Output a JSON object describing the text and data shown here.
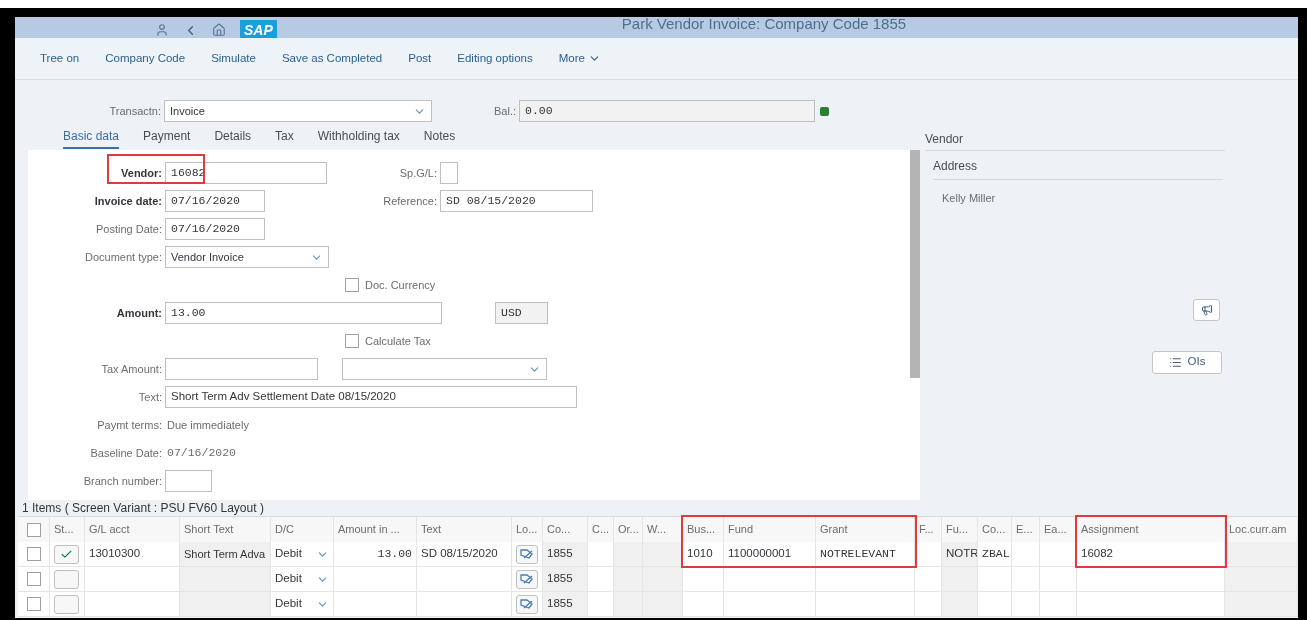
{
  "shell": {
    "logo": "SAP",
    "title": "Park Vendor Invoice: Company Code 1855"
  },
  "toolbar": [
    "Tree on",
    "Company Code",
    "Simulate",
    "Save as Completed",
    "Post",
    "Editing options",
    "More"
  ],
  "transaction": {
    "label": "Transactn:",
    "value": "Invoice"
  },
  "balance": {
    "label": "Bal.:",
    "value": "0.00",
    "balanced": true
  },
  "tabs": [
    {
      "label": "Basic data",
      "selected": true
    },
    {
      "label": "Payment",
      "selected": false
    },
    {
      "label": "Details",
      "selected": false
    },
    {
      "label": "Tax",
      "selected": false
    },
    {
      "label": "Withholding tax",
      "selected": false
    },
    {
      "label": "Notes",
      "selected": false
    }
  ],
  "form": {
    "vendor": {
      "label": "Vendor:",
      "value": "16082",
      "required": true,
      "highlighted": true
    },
    "sp_gl": {
      "label": "Sp.G/L:"
    },
    "invoice_date": {
      "label": "Invoice date:",
      "value": "07/16/2020",
      "required": true
    },
    "reference": {
      "label": "Reference:",
      "value": "SD 08/15/2020"
    },
    "posting_date": {
      "label": "Posting Date:",
      "value": "07/16/2020",
      "required": false
    },
    "document_type": {
      "label": "Document type:",
      "value": "Vendor Invoice",
      "required": false
    },
    "doc_currency": {
      "label": "Doc. Currency",
      "checked": false
    },
    "amount": {
      "label": "Amount:",
      "value": "13.00",
      "required": true
    },
    "currency": {
      "value": "USD"
    },
    "calculate_tax": {
      "label": "Calculate Tax",
      "checked": false
    },
    "tax_amount": {
      "label": "Tax Amount:",
      "required": false
    },
    "text": {
      "label": "Text:",
      "value": "Short Term Adv Settlement Date 08/15/2020",
      "required": false
    },
    "payment_terms": {
      "label": "Paymt terms:",
      "value": "Due immediately"
    },
    "baseline_date": {
      "label": "Baseline Date:",
      "value": "07/16/2020"
    },
    "branch_number": {
      "label": "Branch number:"
    }
  },
  "vendor_panel": {
    "title": "Vendor",
    "section": "Address",
    "name": "Kelly Miller",
    "list_button": "OIs"
  },
  "items": {
    "title": "1 Items ( Screen Variant : PSU FV60 Layout )",
    "select_all": false,
    "columns": [
      {
        "label": "St...",
        "kind": "status",
        "highlighted": false,
        "readonly": false
      },
      {
        "label": "G/L acct",
        "kind": "text",
        "highlighted": false,
        "readonly": false
      },
      {
        "label": "Short Text",
        "kind": "text",
        "highlighted": false,
        "readonly": true
      },
      {
        "label": "D/C",
        "kind": "dropdown",
        "highlighted": false,
        "readonly": false
      },
      {
        "label": "Amount in ...",
        "kind": "number",
        "highlighted": false,
        "readonly": false
      },
      {
        "label": "Text",
        "kind": "text",
        "highlighted": false,
        "readonly": false
      },
      {
        "label": "Lo...",
        "kind": "icon",
        "highlighted": false,
        "readonly": false
      },
      {
        "label": "Co...",
        "kind": "text",
        "highlighted": false,
        "readonly": true
      },
      {
        "label": "C...",
        "kind": "text",
        "highlighted": false,
        "readonly": false
      },
      {
        "label": "Or...",
        "kind": "text",
        "highlighted": false,
        "readonly": true
      },
      {
        "label": "W...",
        "kind": "text",
        "highlighted": false,
        "readonly": true
      },
      {
        "label": "Bus...",
        "kind": "text",
        "highlighted": true,
        "readonly": false
      },
      {
        "label": "Fund",
        "kind": "text",
        "highlighted": true,
        "readonly": false
      },
      {
        "label": "Grant",
        "kind": "code",
        "highlighted": true,
        "readonly": false
      },
      {
        "label": "F...",
        "kind": "text",
        "highlighted": false,
        "readonly": false
      },
      {
        "label": "Fu...",
        "kind": "text",
        "highlighted": false,
        "readonly": true
      },
      {
        "label": "Co...",
        "kind": "code",
        "highlighted": false,
        "readonly": false
      },
      {
        "label": "E...",
        "kind": "text",
        "highlighted": false,
        "readonly": false
      },
      {
        "label": "Ea...",
        "kind": "text",
        "highlighted": false,
        "readonly": false
      },
      {
        "label": "Assignment",
        "kind": "text",
        "highlighted": true,
        "readonly": false
      },
      {
        "label": "Loc.curr.am",
        "kind": "text",
        "highlighted": false,
        "readonly": true
      }
    ],
    "rows": [
      {
        "checked": false,
        "confirmed": true,
        "cells": [
          null,
          "13010300",
          "Short Term Adva",
          "Debit",
          "13.00",
          "SD 08/15/2020",
          null,
          "1855",
          null,
          null,
          null,
          "1010",
          "1100000001",
          "NOTRELEVANT",
          null,
          "NOTR",
          "ZBAL",
          null,
          null,
          "16082",
          null
        ]
      },
      {
        "checked": false,
        "confirmed": false,
        "cells": [
          null,
          null,
          null,
          "Debit",
          null,
          null,
          null,
          "1855",
          null,
          null,
          null,
          null,
          null,
          null,
          null,
          null,
          null,
          null,
          null,
          null,
          null
        ]
      },
      {
        "checked": false,
        "confirmed": false,
        "cells": [
          null,
          null,
          null,
          "Debit",
          null,
          null,
          null,
          "1855",
          null,
          null,
          null,
          null,
          null,
          null,
          null,
          null,
          null,
          null,
          null,
          null,
          null
        ]
      }
    ]
  }
}
